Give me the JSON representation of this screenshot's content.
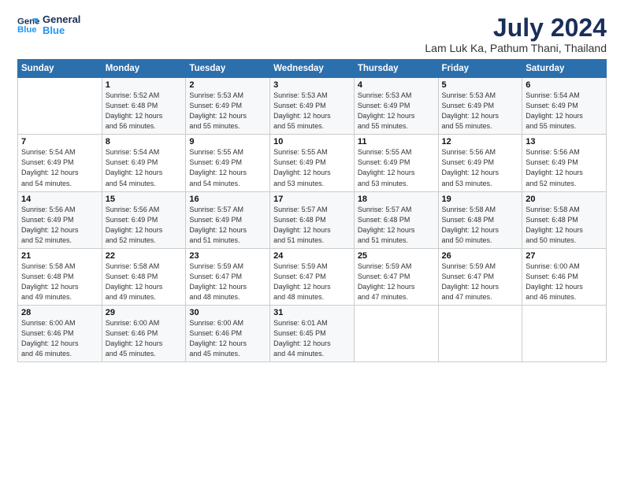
{
  "header": {
    "logo_line1": "General",
    "logo_line2": "Blue",
    "title": "July 2024",
    "subtitle": "Lam Luk Ka, Pathum Thani, Thailand"
  },
  "weekdays": [
    "Sunday",
    "Monday",
    "Tuesday",
    "Wednesday",
    "Thursday",
    "Friday",
    "Saturday"
  ],
  "weeks": [
    [
      {
        "day": "",
        "info": ""
      },
      {
        "day": "1",
        "info": "Sunrise: 5:52 AM\nSunset: 6:48 PM\nDaylight: 12 hours\nand 56 minutes."
      },
      {
        "day": "2",
        "info": "Sunrise: 5:53 AM\nSunset: 6:49 PM\nDaylight: 12 hours\nand 55 minutes."
      },
      {
        "day": "3",
        "info": "Sunrise: 5:53 AM\nSunset: 6:49 PM\nDaylight: 12 hours\nand 55 minutes."
      },
      {
        "day": "4",
        "info": "Sunrise: 5:53 AM\nSunset: 6:49 PM\nDaylight: 12 hours\nand 55 minutes."
      },
      {
        "day": "5",
        "info": "Sunrise: 5:53 AM\nSunset: 6:49 PM\nDaylight: 12 hours\nand 55 minutes."
      },
      {
        "day": "6",
        "info": "Sunrise: 5:54 AM\nSunset: 6:49 PM\nDaylight: 12 hours\nand 55 minutes."
      }
    ],
    [
      {
        "day": "7",
        "info": "Sunrise: 5:54 AM\nSunset: 6:49 PM\nDaylight: 12 hours\nand 54 minutes."
      },
      {
        "day": "8",
        "info": "Sunrise: 5:54 AM\nSunset: 6:49 PM\nDaylight: 12 hours\nand 54 minutes."
      },
      {
        "day": "9",
        "info": "Sunrise: 5:55 AM\nSunset: 6:49 PM\nDaylight: 12 hours\nand 54 minutes."
      },
      {
        "day": "10",
        "info": "Sunrise: 5:55 AM\nSunset: 6:49 PM\nDaylight: 12 hours\nand 53 minutes."
      },
      {
        "day": "11",
        "info": "Sunrise: 5:55 AM\nSunset: 6:49 PM\nDaylight: 12 hours\nand 53 minutes."
      },
      {
        "day": "12",
        "info": "Sunrise: 5:56 AM\nSunset: 6:49 PM\nDaylight: 12 hours\nand 53 minutes."
      },
      {
        "day": "13",
        "info": "Sunrise: 5:56 AM\nSunset: 6:49 PM\nDaylight: 12 hours\nand 52 minutes."
      }
    ],
    [
      {
        "day": "14",
        "info": "Sunrise: 5:56 AM\nSunset: 6:49 PM\nDaylight: 12 hours\nand 52 minutes."
      },
      {
        "day": "15",
        "info": "Sunrise: 5:56 AM\nSunset: 6:49 PM\nDaylight: 12 hours\nand 52 minutes."
      },
      {
        "day": "16",
        "info": "Sunrise: 5:57 AM\nSunset: 6:49 PM\nDaylight: 12 hours\nand 51 minutes."
      },
      {
        "day": "17",
        "info": "Sunrise: 5:57 AM\nSunset: 6:48 PM\nDaylight: 12 hours\nand 51 minutes."
      },
      {
        "day": "18",
        "info": "Sunrise: 5:57 AM\nSunset: 6:48 PM\nDaylight: 12 hours\nand 51 minutes."
      },
      {
        "day": "19",
        "info": "Sunrise: 5:58 AM\nSunset: 6:48 PM\nDaylight: 12 hours\nand 50 minutes."
      },
      {
        "day": "20",
        "info": "Sunrise: 5:58 AM\nSunset: 6:48 PM\nDaylight: 12 hours\nand 50 minutes."
      }
    ],
    [
      {
        "day": "21",
        "info": "Sunrise: 5:58 AM\nSunset: 6:48 PM\nDaylight: 12 hours\nand 49 minutes."
      },
      {
        "day": "22",
        "info": "Sunrise: 5:58 AM\nSunset: 6:48 PM\nDaylight: 12 hours\nand 49 minutes."
      },
      {
        "day": "23",
        "info": "Sunrise: 5:59 AM\nSunset: 6:47 PM\nDaylight: 12 hours\nand 48 minutes."
      },
      {
        "day": "24",
        "info": "Sunrise: 5:59 AM\nSunset: 6:47 PM\nDaylight: 12 hours\nand 48 minutes."
      },
      {
        "day": "25",
        "info": "Sunrise: 5:59 AM\nSunset: 6:47 PM\nDaylight: 12 hours\nand 47 minutes."
      },
      {
        "day": "26",
        "info": "Sunrise: 5:59 AM\nSunset: 6:47 PM\nDaylight: 12 hours\nand 47 minutes."
      },
      {
        "day": "27",
        "info": "Sunrise: 6:00 AM\nSunset: 6:46 PM\nDaylight: 12 hours\nand 46 minutes."
      }
    ],
    [
      {
        "day": "28",
        "info": "Sunrise: 6:00 AM\nSunset: 6:46 PM\nDaylight: 12 hours\nand 46 minutes."
      },
      {
        "day": "29",
        "info": "Sunrise: 6:00 AM\nSunset: 6:46 PM\nDaylight: 12 hours\nand 45 minutes."
      },
      {
        "day": "30",
        "info": "Sunrise: 6:00 AM\nSunset: 6:46 PM\nDaylight: 12 hours\nand 45 minutes."
      },
      {
        "day": "31",
        "info": "Sunrise: 6:01 AM\nSunset: 6:45 PM\nDaylight: 12 hours\nand 44 minutes."
      },
      {
        "day": "",
        "info": ""
      },
      {
        "day": "",
        "info": ""
      },
      {
        "day": "",
        "info": ""
      }
    ]
  ]
}
